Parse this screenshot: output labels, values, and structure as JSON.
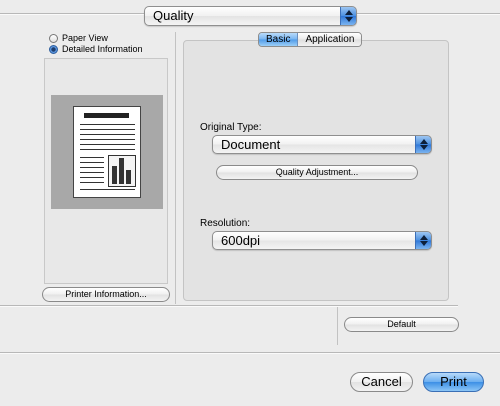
{
  "panel_menu": {
    "selected": "Quality"
  },
  "view_options": {
    "paper_view": "Paper View",
    "detailed_information": "Detailed Information",
    "selected": "Detailed Information"
  },
  "printer_information_label": "Printer Information...",
  "tabs": [
    {
      "label": "Basic",
      "active": true
    },
    {
      "label": "Application",
      "active": false
    }
  ],
  "original_type": {
    "label": "Original Type:",
    "value": "Document"
  },
  "quality_adjustment_label": "Quality Adjustment...",
  "resolution": {
    "label": "Resolution:",
    "value": "600dpi"
  },
  "default_label": "Default",
  "footer": {
    "cancel_label": "Cancel",
    "print_label": "Print"
  },
  "colors": {
    "accent": "#4a8fe0"
  }
}
